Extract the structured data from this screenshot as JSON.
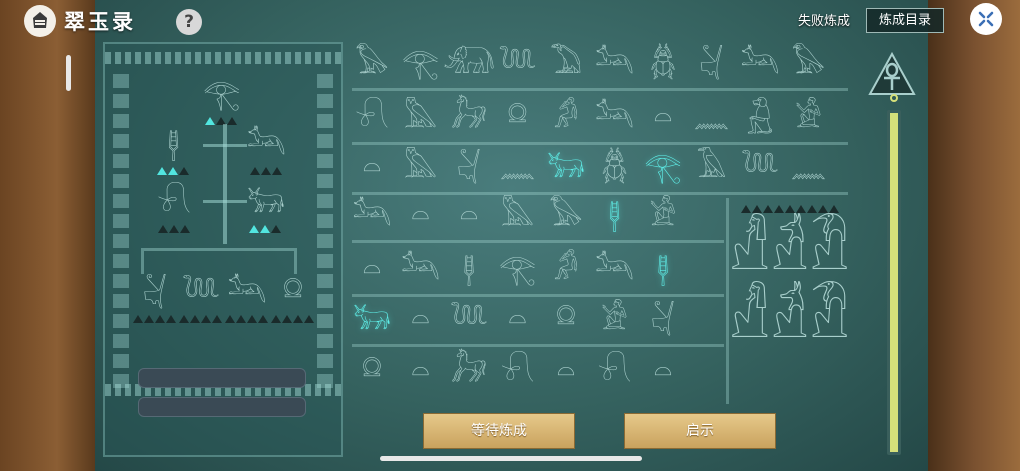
{
  "header": {
    "title": "翠玉录",
    "help_label": "?",
    "fail_link": "失败炼成",
    "catalog_button": "炼成目录"
  },
  "icons": {
    "logo": "sphinx-logo-icon",
    "close": "close-x-icon",
    "ankh": "ankh-icon"
  },
  "recipe_tree": {
    "top": "𓂀",
    "row2": [
      "𓊢",
      "𓃢"
    ],
    "row3": [
      "𓍯",
      "𓃒"
    ],
    "bottom": [
      "𓋔",
      "𓆙",
      "𓃢",
      "𓍶"
    ]
  },
  "grid_rows": [
    [
      "𓅃",
      "𓂀",
      "𓃰",
      "𓆙",
      "𓅐",
      "𓃢",
      "𓆣",
      "𓋔",
      "𓃢",
      "𓅃"
    ],
    [
      "𓍯",
      "𓅓",
      "𓃗",
      "𓍶",
      "𓀔",
      "𓃢",
      "𓏏",
      "𓈖",
      "𓃻",
      "𓀀"
    ],
    [
      "𓏏",
      "𓅓",
      "𓋔",
      "𓈖",
      "𓃒",
      "𓆣",
      "𓂀",
      "𓄿",
      "𓆙",
      "𓈖"
    ],
    [
      "𓃢",
      "𓏏",
      "𓏏",
      "𓅓",
      "𓅃",
      "𓊢",
      "𓀀"
    ],
    [
      "𓏏",
      "𓃢",
      "𓊢",
      "𓂀",
      "𓀔",
      "𓃢",
      "𓊢"
    ],
    [
      "𓃒",
      "𓏏",
      "𓆙",
      "𓏏",
      "𓍶",
      "𓀀",
      "𓋔"
    ],
    [
      "𓍶",
      "𓏏",
      "𓃗",
      "𓍯",
      "𓏏",
      "𓍯",
      "𓏏"
    ]
  ],
  "highlighted": [
    "2-4",
    "2-6",
    "3-5",
    "4-6",
    "5-0"
  ],
  "side_figures": [
    "𓀭",
    "𓁢",
    "𓁟",
    "𓀭",
    "𓁢",
    "𓁟"
  ],
  "buttons": {
    "wait": "等待炼成",
    "hint": "启示"
  },
  "colors": {
    "board": "#35625f",
    "highlight": "#5ff0ea",
    "button": "#d4b06f"
  }
}
